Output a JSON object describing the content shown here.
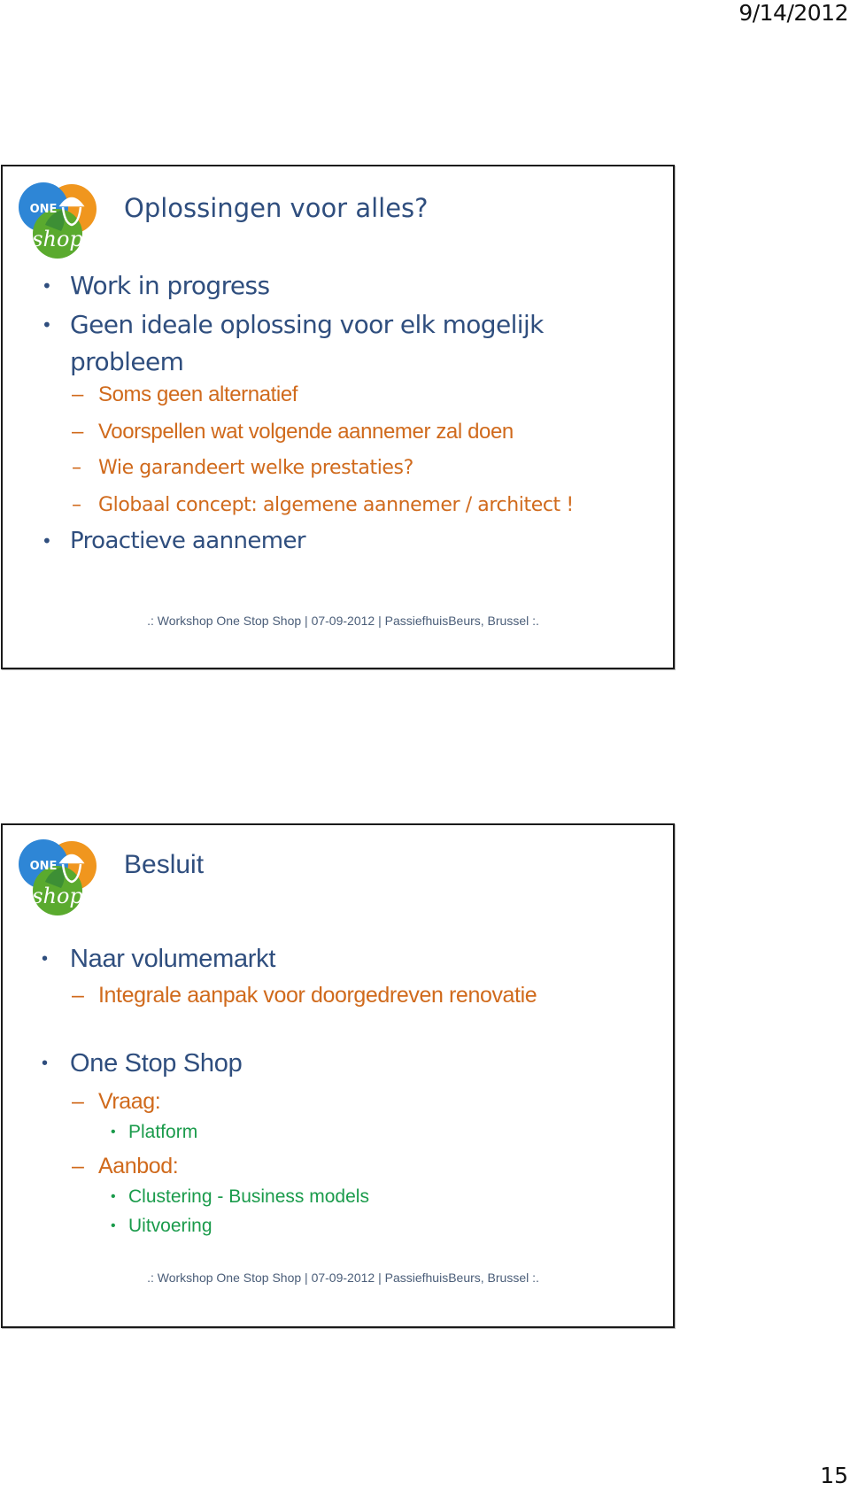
{
  "page": {
    "date": "9/14/2012",
    "page_number": "15"
  },
  "logo": {
    "one_text": "ONE",
    "shop_text": "shop",
    "colors": {
      "blue": "#2e86d6",
      "orange": "#f0961e",
      "green": "#5aaa2e"
    }
  },
  "colors": {
    "title": "#2f4e7e",
    "level2": "#d06a1c",
    "level3": "#1a9b4b"
  },
  "slides": [
    {
      "title": "Oplossingen voor alles?",
      "items": [
        {
          "level": 1,
          "text": "Work in progress"
        },
        {
          "level": 1,
          "text": "Geen ideale oplossing voor elk mogelijk",
          "text2": "probleem"
        },
        {
          "level": 2,
          "text": "Soms geen alternatief"
        },
        {
          "level": 2,
          "text": "Voorspellen wat volgende aannemer zal doen"
        },
        {
          "level": 2,
          "text": "Wie garandeert welke prestaties?"
        },
        {
          "level": 2,
          "text": "Globaal concept: algemene aannemer / architect !"
        },
        {
          "level": 1,
          "text": "Proactieve aannemer"
        }
      ],
      "footer": ".: Workshop One Stop Shop | 07-09-2012 | PassiefhuisBeurs, Brussel :."
    },
    {
      "title": "Besluit",
      "items": [
        {
          "level": 1,
          "text": "Naar volumemarkt"
        },
        {
          "level": 2,
          "text": "Integrale aanpak voor doorgedreven renovatie"
        },
        {
          "level": 1,
          "text": "One Stop Shop"
        },
        {
          "level": 2,
          "text": "Vraag:"
        },
        {
          "level": 3,
          "text": "Platform"
        },
        {
          "level": 2,
          "text": "Aanbod:"
        },
        {
          "level": 3,
          "text": "Clustering - Business models"
        },
        {
          "level": 3,
          "text": "Uitvoering"
        }
      ],
      "footer": ".: Workshop One Stop Shop | 07-09-2012 | PassiefhuisBeurs, Brussel :."
    }
  ],
  "glyphs": {
    "bullet": "•",
    "dash": "–"
  }
}
